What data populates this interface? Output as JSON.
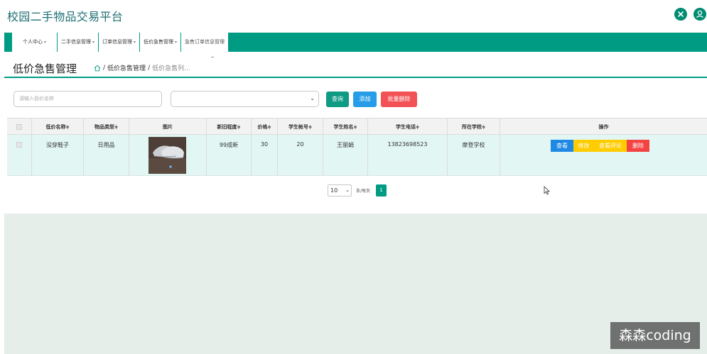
{
  "header": {
    "app_title": "校园二手物品交易平台",
    "icons": [
      "close-circle-icon",
      "user-icon"
    ]
  },
  "nav": {
    "tabs": [
      {
        "label": "个人中心"
      },
      {
        "label": "二手信息管理"
      },
      {
        "label": "订单信息管理"
      },
      {
        "label": "低价急售管理"
      },
      {
        "label": "急售订单信息管理"
      }
    ],
    "caret": "▾"
  },
  "page": {
    "title": "低价急售管理",
    "breadcrumb": {
      "sep": "/",
      "item1": "低价急售管理",
      "item2": "低价急售列..."
    }
  },
  "search": {
    "placeholder": "请输入低价名称",
    "select_value": "",
    "query_label": "查询",
    "add_label": "添加",
    "batch_delete_label": "批量删除"
  },
  "table": {
    "sort_mark": "≑",
    "columns": [
      "低价名称",
      "物品类型",
      "图片",
      "新旧程度",
      "价格",
      "学生帐号",
      "学生姓名",
      "学生电话",
      "所在学校",
      "操作"
    ],
    "rows": [
      {
        "name": "没穿鞋子",
        "type": "日用品",
        "condition": "99成新",
        "price": "30",
        "student_account": "20",
        "student_name": "王丽娟",
        "student_phone": "13823698523",
        "school": "摩登学校",
        "actions": {
          "view": "查看",
          "edit": "修改",
          "reviews": "查看评论",
          "delete": "删除"
        }
      }
    ]
  },
  "pagination": {
    "page_size": "10",
    "label": "条/每页",
    "current_page": "1"
  },
  "watermark": "森森coding",
  "colors": {
    "primary": "#009b83",
    "blue": "#259de8",
    "red": "#f25156",
    "yellow": "#ffcc00"
  }
}
